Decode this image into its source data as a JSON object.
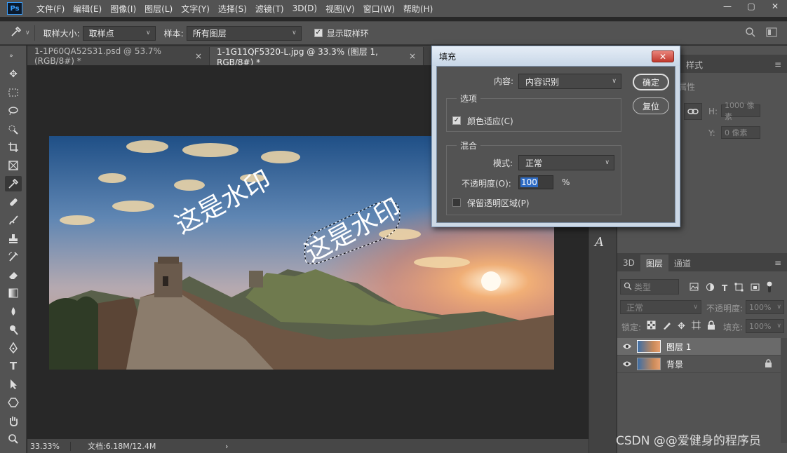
{
  "app": {
    "logo": "Ps"
  },
  "menu": [
    "文件(F)",
    "编辑(E)",
    "图像(I)",
    "图层(L)",
    "文字(Y)",
    "选择(S)",
    "滤镜(T)",
    "3D(D)",
    "视图(V)",
    "窗口(W)",
    "帮助(H)"
  ],
  "window_controls": {
    "minimize": "—",
    "maximize": "▢",
    "close": "✕"
  },
  "options": {
    "sample_size_label": "取样大小:",
    "sample_size_value": "取样点",
    "sample_label": "样本:",
    "sample_value": "所有图层",
    "show_ring_label": "显示取样环"
  },
  "tabs": [
    {
      "label": "1-1P60QA52S31.psd @ 53.7%(RGB/8#) *",
      "close": "×"
    },
    {
      "label": "1-1G11QF5320-L.jpg @ 33.3% (图层 1, RGB/8#) *",
      "close": "×"
    }
  ],
  "canvas": {
    "watermark_left": "这是水印",
    "watermark_selected": "这是水印"
  },
  "status": {
    "zoom": "33.33%",
    "doc": "文档:6.18M/12.4M",
    "arrow": "›"
  },
  "dialog": {
    "title": "填充",
    "close": "✕",
    "content_label": "内容:",
    "content_value": "内容识别",
    "options_group": "选项",
    "color_adapt_label": "颜色适应(C)",
    "blend_group": "混合",
    "mode_label": "模式:",
    "mode_value": "正常",
    "opacity_label": "不透明度(O):",
    "opacity_value": "100",
    "opacity_unit": "%",
    "preserve_label": "保留透明区域(P)",
    "ok": "确定",
    "reset": "复位"
  },
  "properties": {
    "tab_styles": "样式",
    "tab_props": "属性",
    "h_label": "H:",
    "h_value": "1000 像素",
    "y_label": "Y:",
    "y_value": "0 像素"
  },
  "layers_panel": {
    "tabs": [
      "3D",
      "图层",
      "通道"
    ],
    "kind_placeholder": "类型",
    "blend_mode": "正常",
    "opacity_label": "不透明度:",
    "opacity_value": "100%",
    "lock_label": "锁定:",
    "fill_label": "填充:",
    "fill_value": "100%",
    "layers": [
      {
        "name": "图层 1",
        "selected": true
      },
      {
        "name": "背景",
        "selected": false,
        "locked": true
      }
    ]
  },
  "footer_watermark": "CSDN @@爱健身的程序员"
}
